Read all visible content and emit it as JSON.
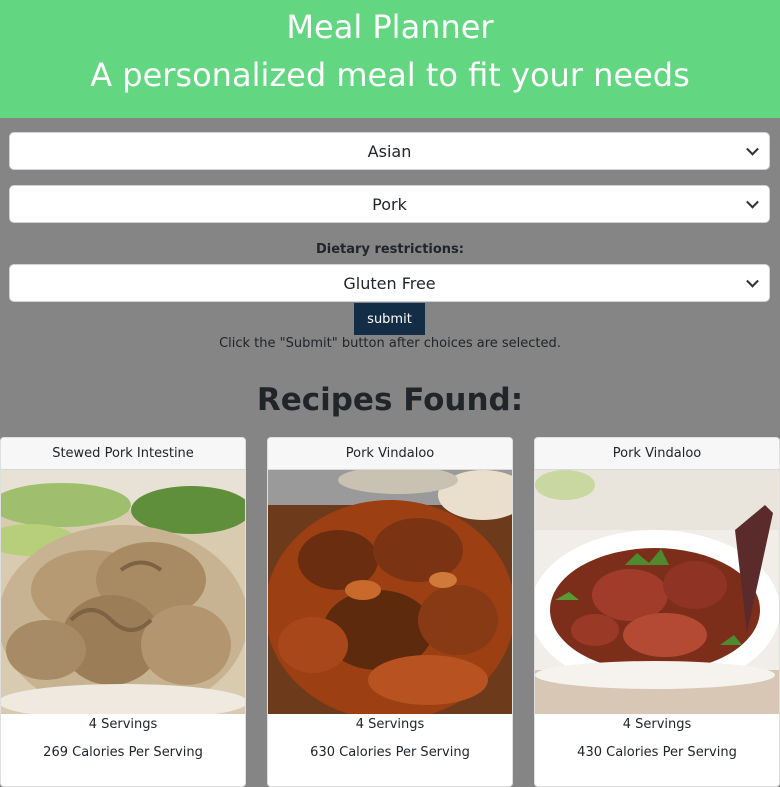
{
  "header": {
    "title": "Meal Planner",
    "subtitle": "A personalized meal to fit your needs"
  },
  "form": {
    "cuisine": "Asian",
    "protein": "Pork",
    "dietary_label": "Dietary restrictions:",
    "diet": "Gluten Free",
    "submit_label": "submit",
    "hint": "Click the \"Submit\" button after choices are selected."
  },
  "results": {
    "heading": "Recipes Found:",
    "recipes": [
      {
        "name": "Stewed Pork Intestine",
        "servings": "4 Servings",
        "calories": "269 Calories Per Serving"
      },
      {
        "name": "Pork Vindaloo",
        "servings": "4 Servings",
        "calories": "630 Calories Per Serving"
      },
      {
        "name": "Pork Vindaloo",
        "servings": "4 Servings",
        "calories": "430 Calories Per Serving"
      }
    ]
  }
}
